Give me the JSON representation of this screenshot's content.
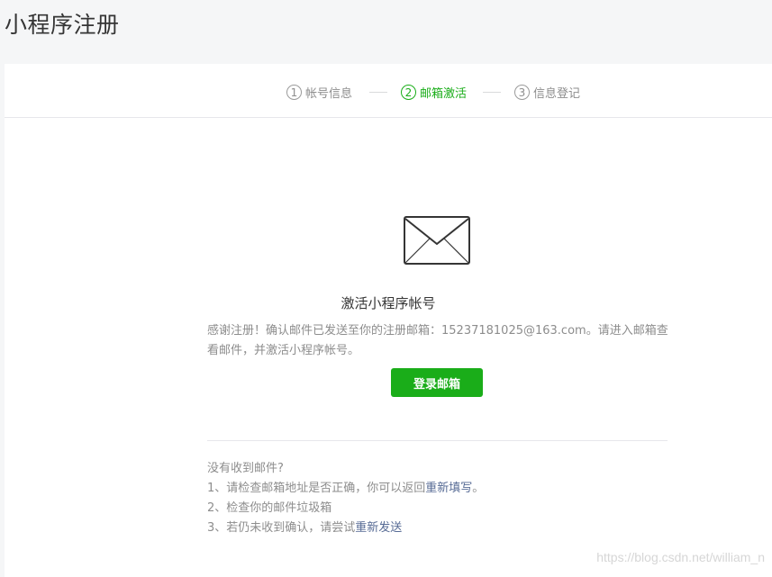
{
  "page": {
    "title": "小程序注册"
  },
  "steps": [
    {
      "num": "1",
      "label": "帐号信息",
      "active": false
    },
    {
      "num": "2",
      "label": "邮箱激活",
      "active": true
    },
    {
      "num": "3",
      "label": "信息登记",
      "active": false
    }
  ],
  "main": {
    "icon": "envelope-icon",
    "heading": "激活小程序帐号",
    "description": "感谢注册！确认邮件已发送至你的注册邮箱：15237181025@163.com。请进入邮箱查看邮件，并激活小程序帐号。",
    "login_button": "登录邮箱"
  },
  "help": {
    "title": "没有收到邮件?",
    "item1_text": "1、请检查邮箱地址是否正确，你可以返回",
    "item1_link": "重新填写",
    "item1_suffix": "。",
    "item2_text": "2、检查你的邮件垃圾箱",
    "item3_text": "3、若仍未收到确认，请尝试",
    "item3_link": "重新发送"
  },
  "watermark": "https://blog.csdn.net/william_n",
  "colors": {
    "accent": "#1aad19",
    "link": "#576b95",
    "muted_text": "#8d8d8d",
    "background": "#f5f6f7"
  }
}
